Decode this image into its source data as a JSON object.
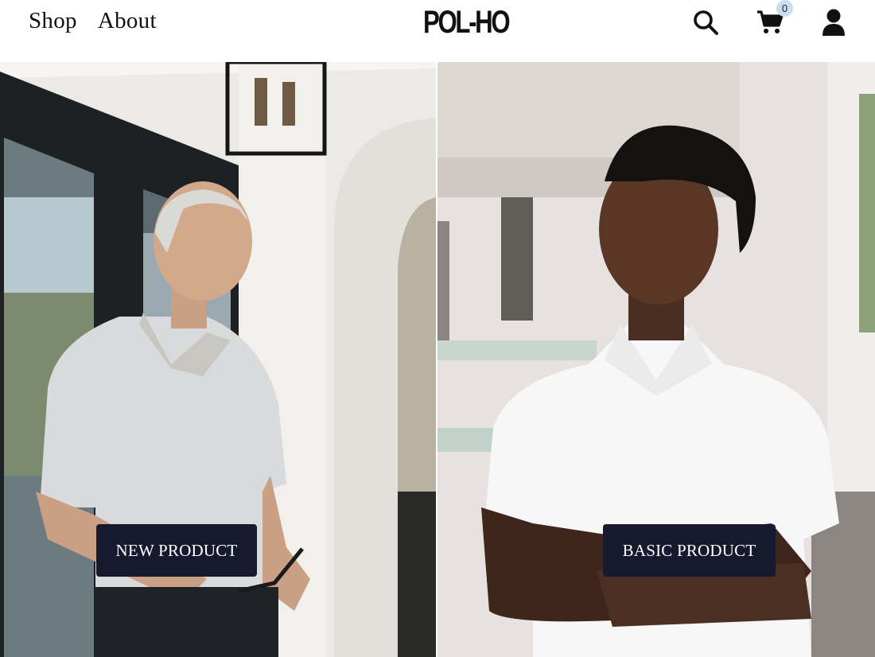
{
  "header": {
    "nav": [
      {
        "label": "Shop"
      },
      {
        "label": "About"
      }
    ],
    "logo": "POL-HO",
    "icons": {
      "search": "search-icon",
      "cart": "cart-icon",
      "user": "user-icon"
    },
    "cart_count": "0"
  },
  "hero": {
    "left": {
      "button_label": "NEW PRODUCT",
      "image": "older man in light striped polo shirt on white porch"
    },
    "right": {
      "button_label": "BASIC PRODUCT",
      "image": "man in white polo shirt with arms crossed"
    }
  },
  "colors": {
    "button_bg": "#171a2e",
    "badge_bg": "#c9def3",
    "text": "#111111"
  }
}
